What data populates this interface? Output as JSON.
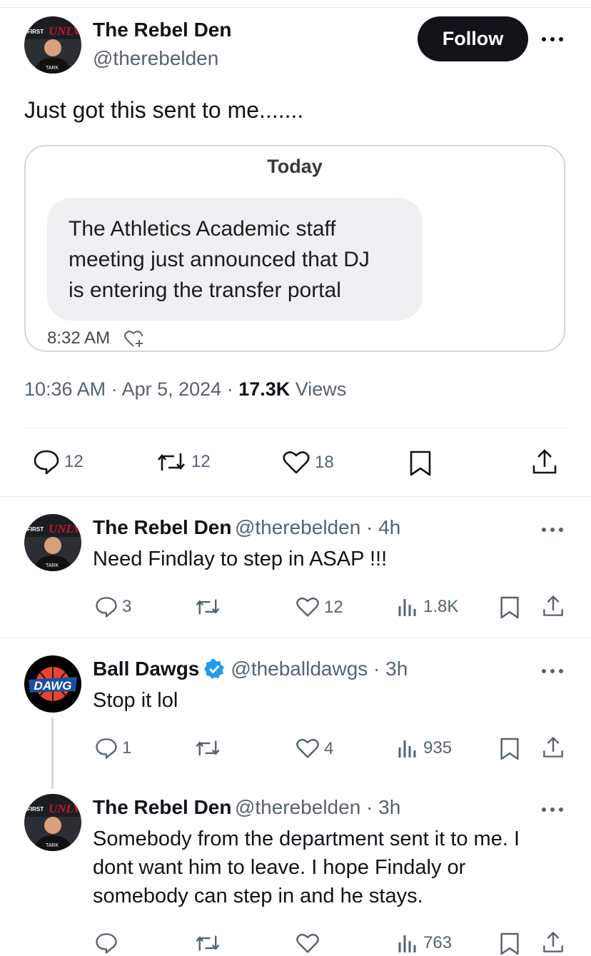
{
  "main_tweet": {
    "author_name": "The Rebel Den",
    "author_handle": "@therebelden",
    "follow_label": "Follow",
    "text": "Just got this sent to me.......",
    "quoted_message": {
      "day_label": "Today",
      "lines": [
        "The Athletics Academic staff",
        "meeting just announced that DJ",
        "is entering the transfer portal"
      ],
      "time": "8:32 AM"
    },
    "time": "10:36 AM",
    "sep1": " · ",
    "date": "Apr 5, 2024",
    "sep2": " · ",
    "views_count": "17.3K",
    "views_label": " Views",
    "stats": {
      "replies": "12",
      "reposts": "12",
      "likes": "18"
    }
  },
  "replies": [
    {
      "author_name": "The Rebel Den",
      "author_handle": "@therebelden · 4h",
      "text_lines": [
        "Need Findlay to step in ASAP !!!"
      ],
      "stats": {
        "replies": "3",
        "reposts": "",
        "likes": "12",
        "views": "1.8K"
      }
    },
    {
      "author_name": "Ball Dawgs",
      "author_handle": "@theballdawgs · 3h",
      "verified": true,
      "text_lines": [
        "Stop it lol"
      ],
      "stats": {
        "replies": "1",
        "reposts": "",
        "likes": "4",
        "views": "935"
      }
    },
    {
      "author_name": "The Rebel Den",
      "author_handle": "@therebelden · 3h",
      "text_lines": [
        "Somebody from the department sent it to me. I",
        "dont want him to leave.  I hope Findaly or",
        "somebody can step in and he stays."
      ],
      "stats": {
        "replies": "",
        "reposts": "",
        "likes": "",
        "views": "763"
      }
    }
  ],
  "avatar_rebel": {
    "logo_top": "FIRST",
    "logo_text": "UNLV",
    "shirt_text": "TARK"
  },
  "avatar_dawgs": {
    "logo_text": "DAWG"
  },
  "colors": {
    "accent": "#1d9bf0",
    "text": "#0f1419",
    "muted": "#536471",
    "border": "#cfd9de"
  }
}
